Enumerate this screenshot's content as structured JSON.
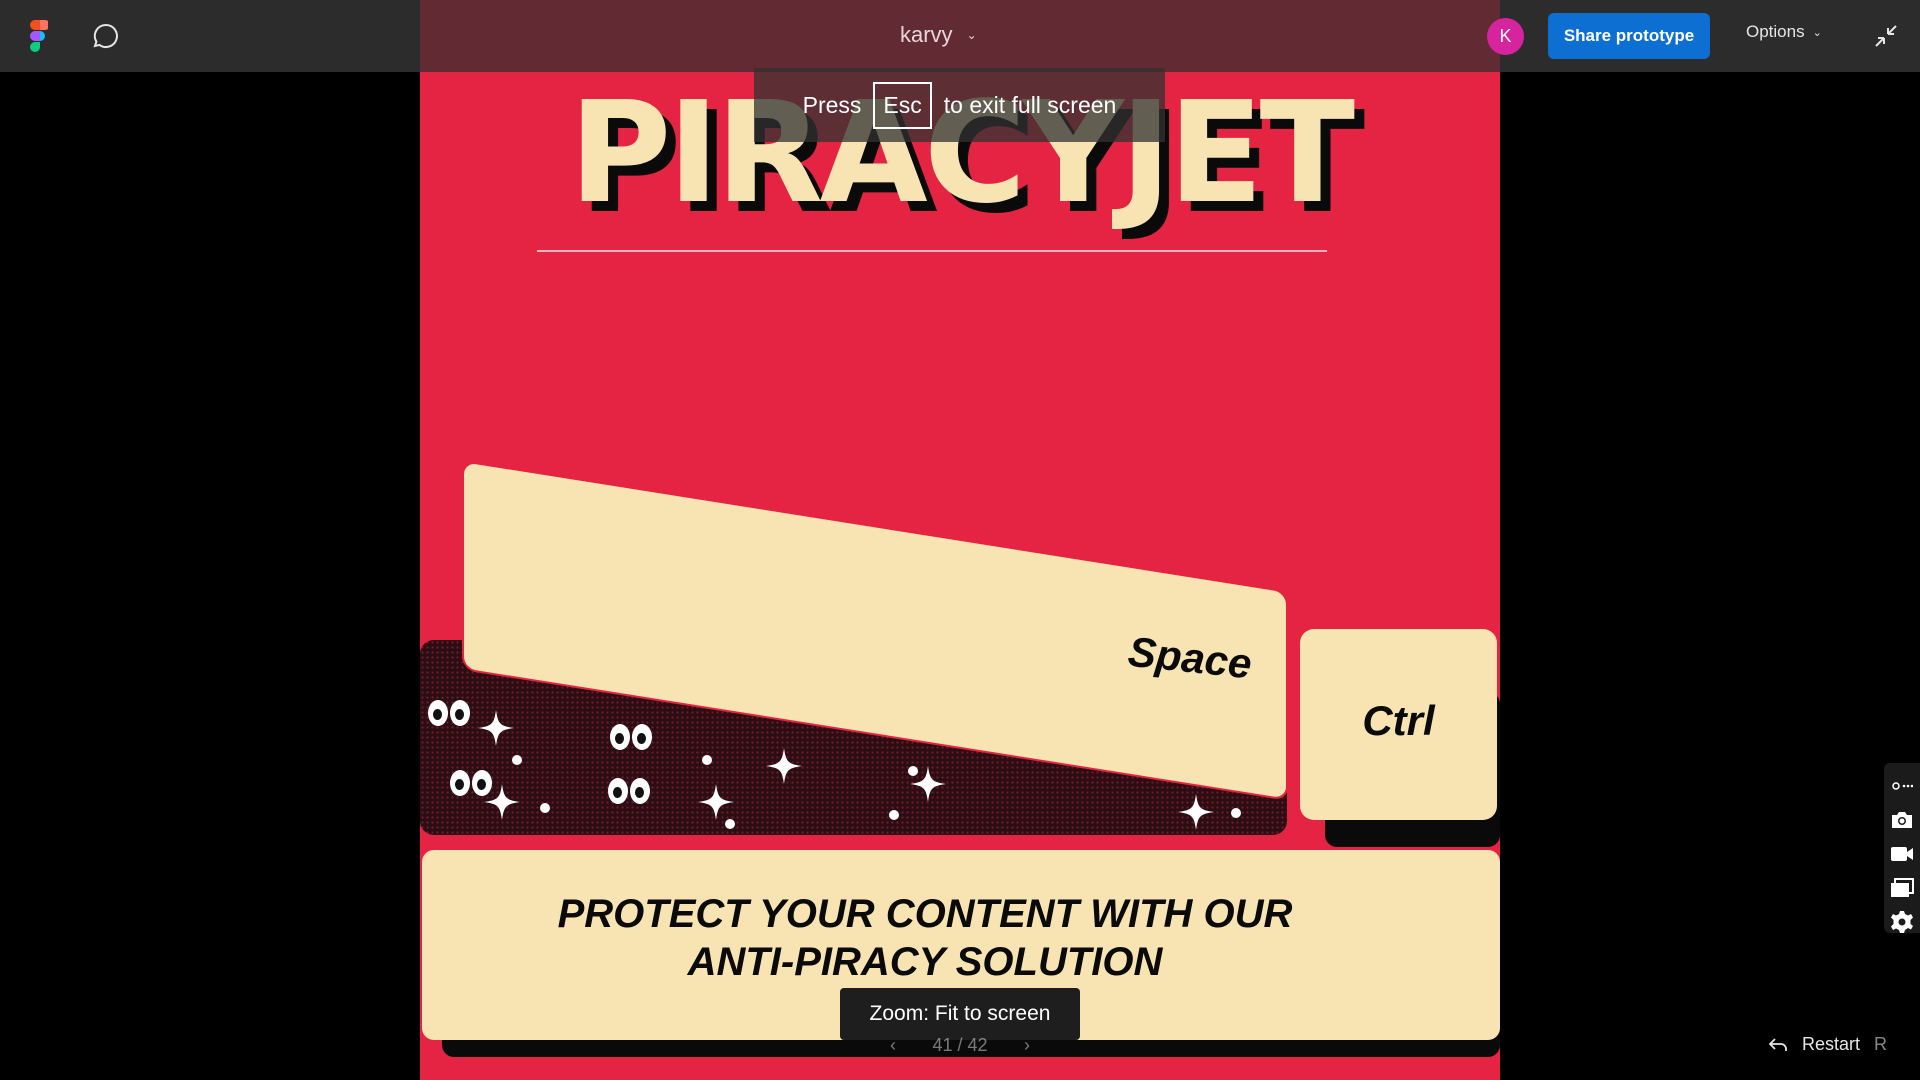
{
  "topbar": {
    "file_name": "karvy",
    "avatar_initial": "K",
    "share_label": "Share prototype",
    "options_label": "Options"
  },
  "slide": {
    "title": "PIRACYJET",
    "space_key_label": "Space",
    "ctrl_key_label": "Ctrl",
    "tagline_line1": "PROTECT YOUR CONTENT  WITH OUR",
    "tagline_line2": "ANTI-PIRACY SOLUTION"
  },
  "overlay": {
    "esc_prefix": "Press",
    "esc_key": "Esc",
    "esc_suffix": "to exit full screen",
    "zoom_tooltip": "Zoom: Fit to screen"
  },
  "pager": {
    "page_indicator": "41 / 42"
  },
  "restart": {
    "label": "Restart",
    "shortcut": "R"
  },
  "colors": {
    "slide_background": "#e42442",
    "cream": "#f7e4b2",
    "share_button": "#0d6fd1",
    "avatar": "#d6249f"
  },
  "icons": {
    "app_logo": "figma-logo-icon",
    "comment": "comment-icon",
    "collapse": "collapse-fullscreen-icon",
    "prev": "chevron-left-icon",
    "next": "chevron-right-icon",
    "restart": "restart-arrow-icon",
    "side_tools": [
      "settings-small-icon",
      "camera-icon",
      "video-camera-icon",
      "layers-icon",
      "gear-icon"
    ]
  }
}
